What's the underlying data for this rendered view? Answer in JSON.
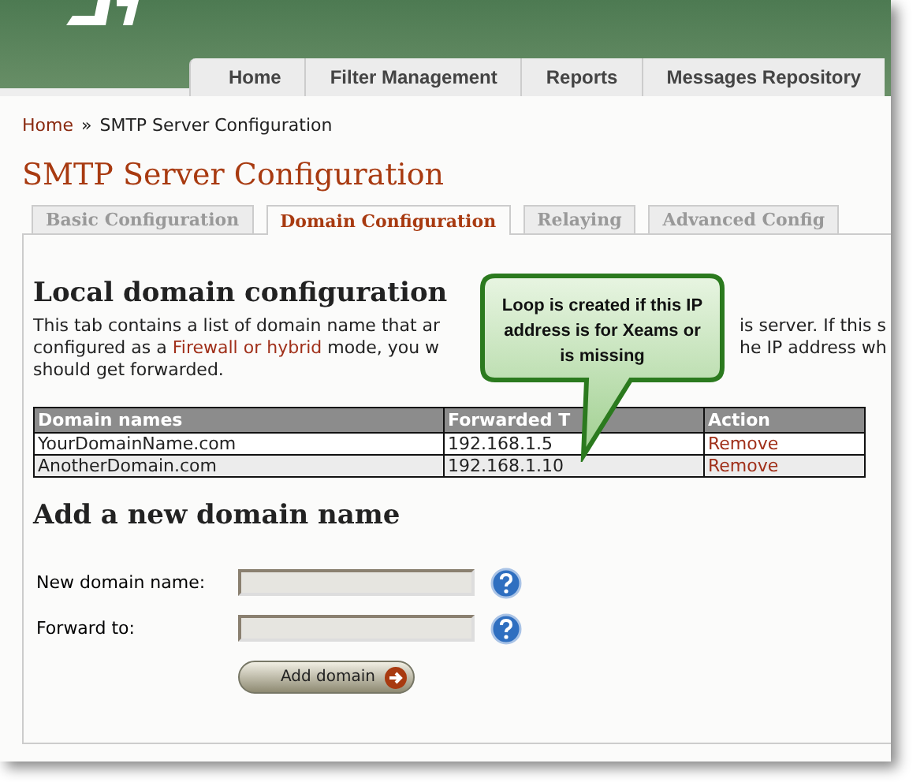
{
  "nav_tabs": [
    {
      "label": "Home",
      "selected": false
    },
    {
      "label": "Filter Management",
      "selected": false
    },
    {
      "label": "Reports",
      "selected": false
    },
    {
      "label": "Messages Repository",
      "selected": false
    }
  ],
  "breadcrumb": {
    "link": "Home",
    "separator": "»",
    "current": "SMTP Server Configuration"
  },
  "page_title": "SMTP Server Configuration",
  "sub_tabs": [
    {
      "label": "Basic Configuration",
      "selected": false
    },
    {
      "label": "Domain Configuration",
      "selected": true
    },
    {
      "label": "Relaying",
      "selected": false
    },
    {
      "label": "Advanced Config",
      "selected": false
    }
  ],
  "section_heading": "Local domain configuration",
  "description_lines": [
    {
      "left": [
        {
          "kind": "text",
          "text": "This tab contains a list of domain name that ar"
        }
      ],
      "right": "is server. If this s"
    },
    {
      "left": [
        {
          "kind": "text",
          "text": "configured as a "
        },
        {
          "kind": "link",
          "text": "Firewall or hybrid"
        },
        {
          "kind": "text",
          "text": " mode, you w"
        }
      ],
      "right": "he IP address wh"
    },
    {
      "left": [
        {
          "kind": "text",
          "text": "should get forwarded."
        }
      ]
    }
  ],
  "table": {
    "columns": [
      "Domain names",
      "Forwarded T",
      "Action"
    ],
    "rows": [
      {
        "domain": "YourDomainName.com",
        "forward": "192.168.1.5",
        "action": "Remove"
      },
      {
        "domain": "AnotherDomain.com",
        "forward": "192.168.1.10",
        "action": "Remove"
      }
    ]
  },
  "add_heading": "Add a new domain name",
  "form_fields": [
    {
      "label": "New domain name:"
    },
    {
      "label": "Forward to:"
    }
  ],
  "submit_button": "Add domain",
  "callout": "Loop is created if this IP address is for Xeams or is missing"
}
